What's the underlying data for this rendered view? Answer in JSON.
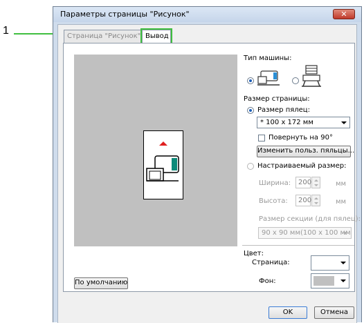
{
  "callout": {
    "number": "1"
  },
  "window": {
    "title": "Параметры страницы \"Рисунок\"",
    "close_symbol": "✕"
  },
  "tabs": [
    {
      "label": "Страница \"Рисунок\"",
      "active": false
    },
    {
      "label": "Вывод",
      "active": true
    }
  ],
  "machine_type": {
    "label": "Тип машины:",
    "options": [
      {
        "icon": "sewing-machine-icon",
        "selected": true
      },
      {
        "icon": "multi-needle-machine-icon",
        "selected": false
      }
    ]
  },
  "page_size": {
    "label": "Размер страницы:",
    "hoop_size_option": {
      "label": "Размер пялец:",
      "selected": true
    },
    "hoop_select": {
      "value": "* 100 x 172 мм"
    },
    "rotate_checkbox": {
      "label": "Повернуть на 90°",
      "checked": false
    },
    "change_hoops_button": "Изменить польз. пяльцы...",
    "custom_size_option": {
      "label": "Настраиваемый размер:",
      "selected": false
    },
    "width": {
      "label": "Ширина:",
      "value": "200",
      "unit": "мм"
    },
    "height": {
      "label": "Высота:",
      "value": "200",
      "unit": "мм"
    },
    "section_size": {
      "label": "Размер секции (для пялец):",
      "value": "90 x  90 мм(100 x 100 мм"
    }
  },
  "color": {
    "label": "Цвет:",
    "page": {
      "label": "Страница:",
      "swatch": "#ffffff"
    },
    "background": {
      "label": "Фон:",
      "swatch": "#c0c0c0"
    }
  },
  "buttons": {
    "default": "По умолчанию",
    "ok": "OK",
    "cancel": "Отмена"
  },
  "colors": {
    "accent_callout": "#3fbf3f",
    "hoop_marker": "#e02020",
    "preview_bg": "#c0c0c0"
  }
}
